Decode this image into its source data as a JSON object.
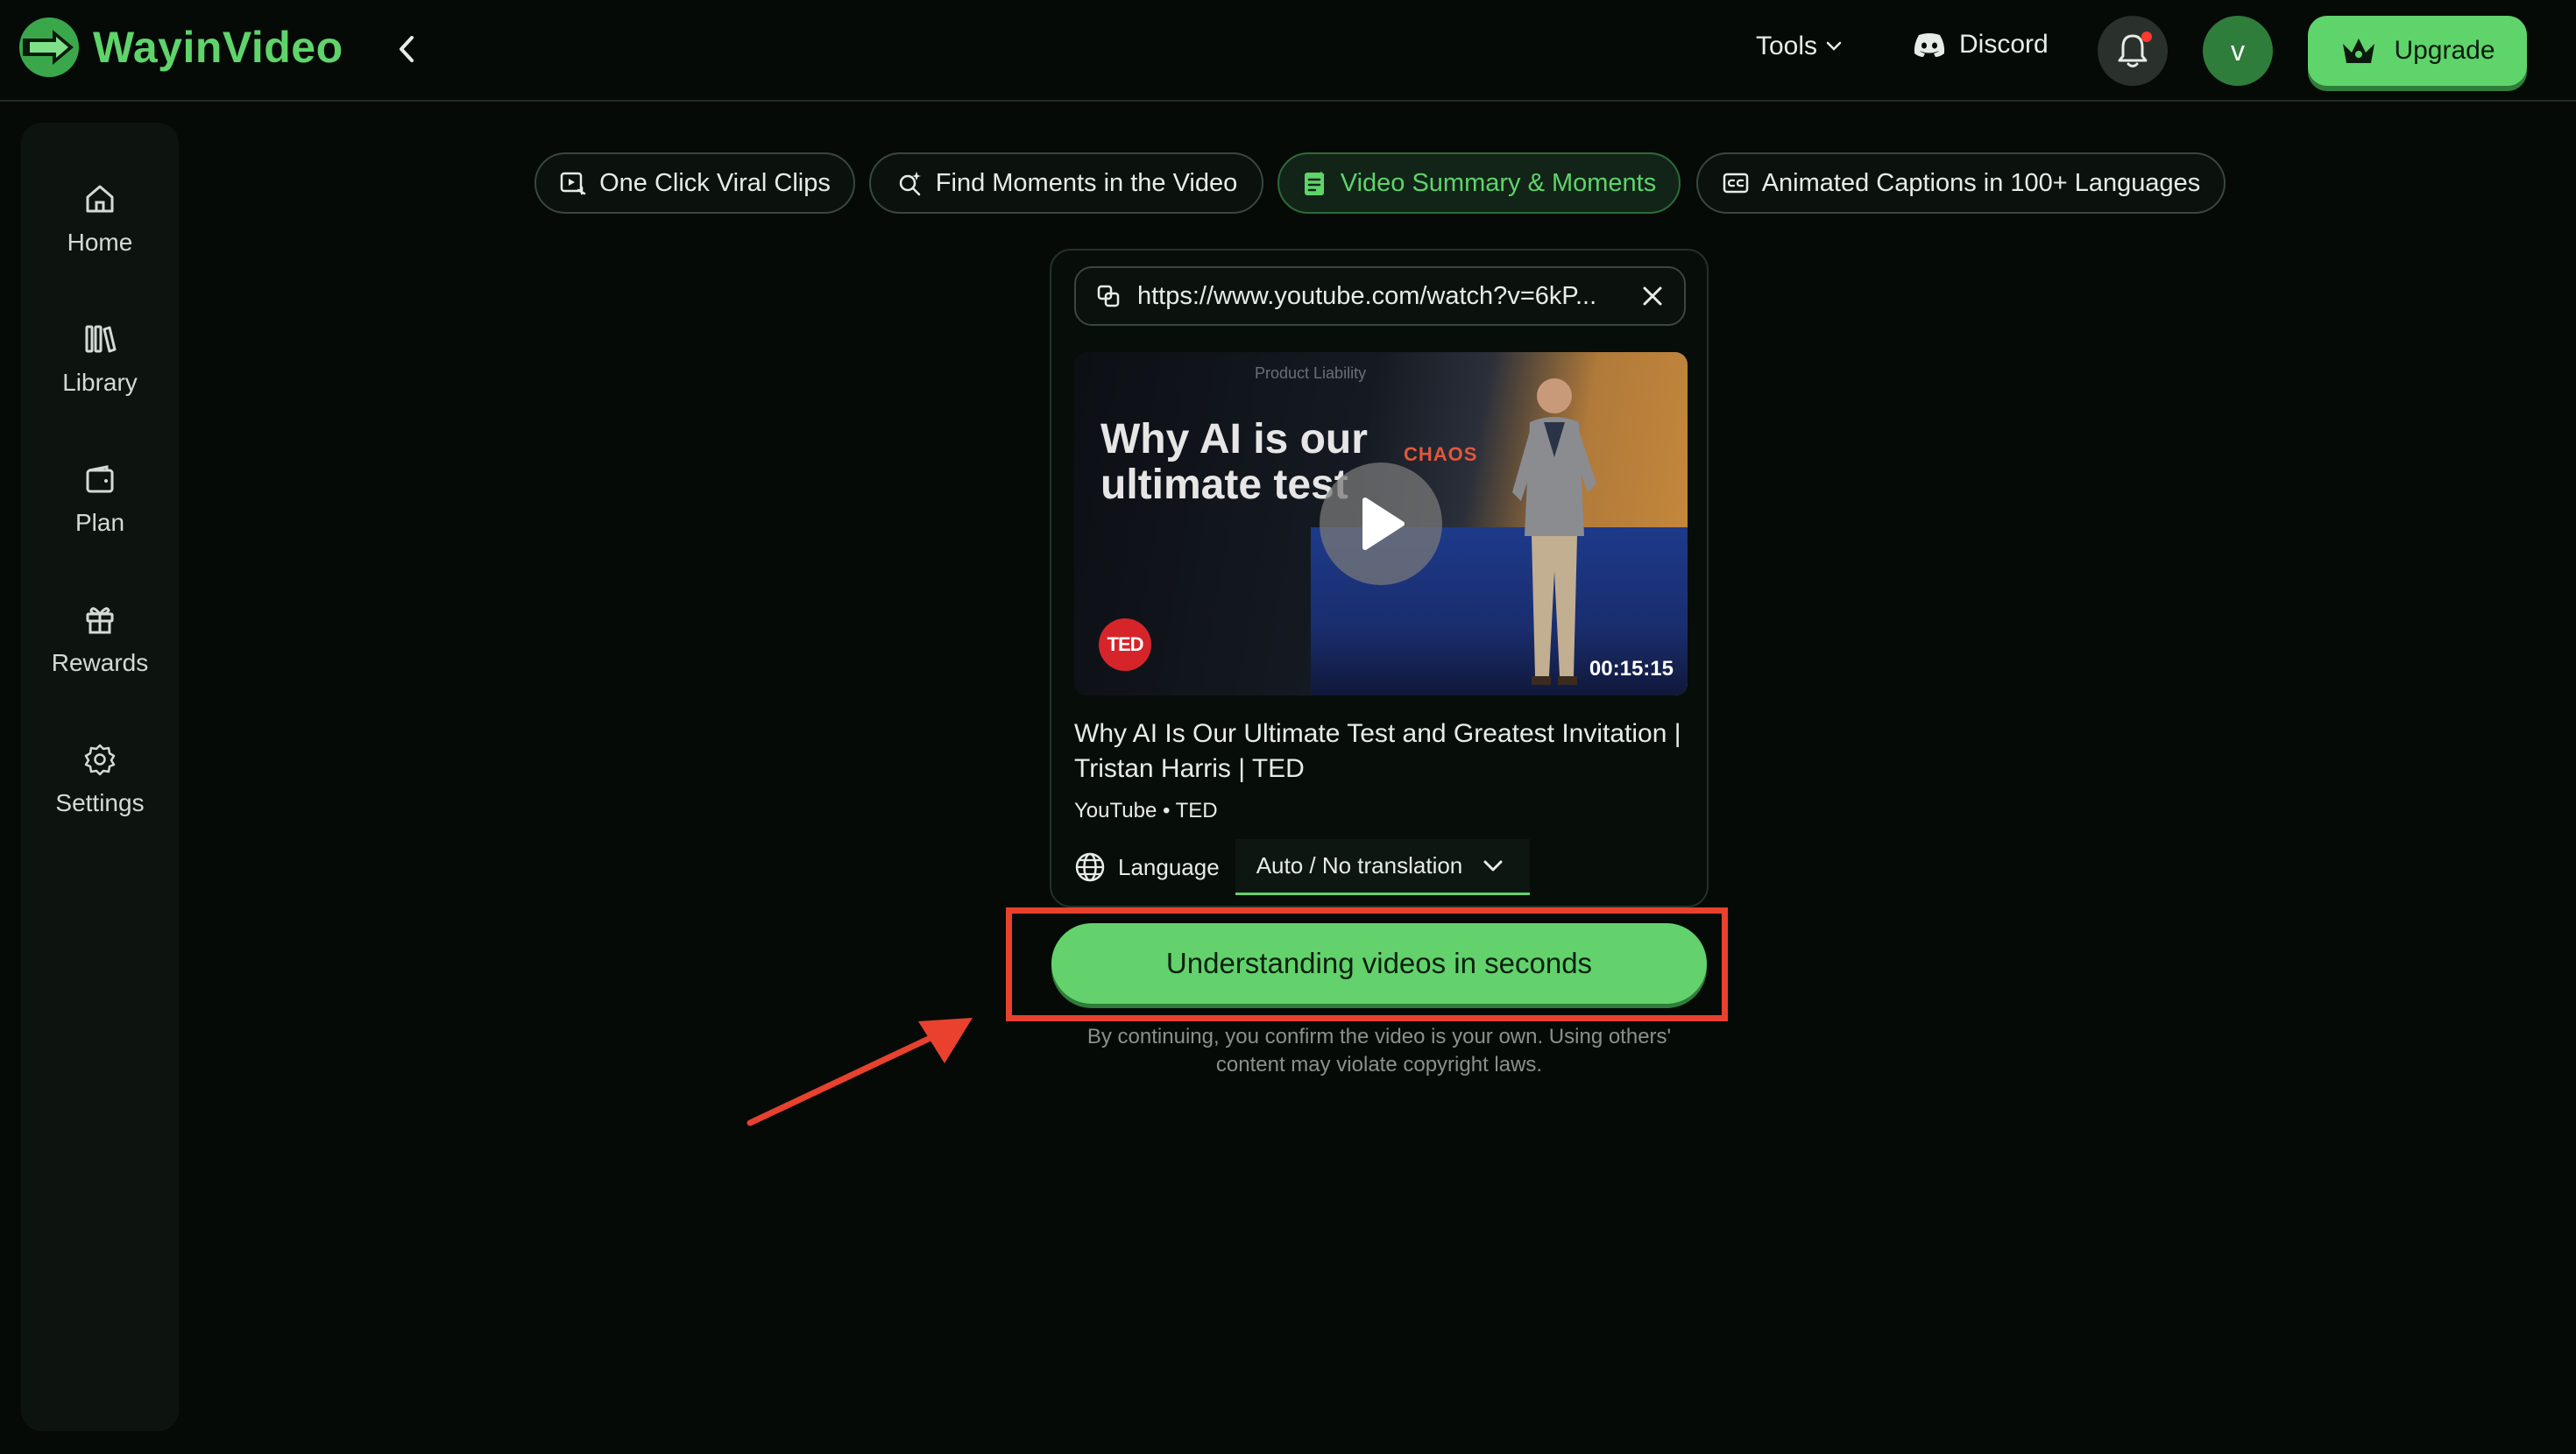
{
  "app": {
    "name": "WayinVideo",
    "brand_color": "#5fd46a"
  },
  "header": {
    "tools_label": "Tools",
    "discord_label": "Discord",
    "avatar_initial": "v",
    "upgrade_label": "Upgrade"
  },
  "sidebar": {
    "items": [
      {
        "label": "Home",
        "icon": "home-icon"
      },
      {
        "label": "Library",
        "icon": "library-icon"
      },
      {
        "label": "Plan",
        "icon": "wallet-icon"
      },
      {
        "label": "Rewards",
        "icon": "gift-icon"
      },
      {
        "label": "Settings",
        "icon": "gear-icon"
      }
    ]
  },
  "tabs": [
    {
      "label": "One Click Viral Clips",
      "icon": "clip-icon",
      "active": false
    },
    {
      "label": "Find Moments in the Video",
      "icon": "magic-search-icon",
      "active": false
    },
    {
      "label": "Video Summary & Moments",
      "icon": "summary-icon",
      "active": true
    },
    {
      "label": "Animated Captions in 100+ Languages",
      "icon": "captions-icon",
      "active": false
    }
  ],
  "input": {
    "url": "https://www.youtube.com/watch?v=6kP..."
  },
  "video": {
    "thumb_title": "Why AI is our ultimate test",
    "thumb_chaos": "CHAOS",
    "thumb_caption": "Product Liability",
    "thumb_badge": "TED",
    "duration": "00:15:15",
    "title": "Why AI Is Our Ultimate Test and Greatest Invitation | Tristan Harris | TED",
    "meta": "YouTube • TED"
  },
  "language": {
    "label": "Language",
    "selected": "Auto / No translation"
  },
  "cta": {
    "label": "Understanding videos in seconds",
    "disclaimer": "By continuing, you confirm the video is your own. Using others' content may violate copyright laws.",
    "highlight_color": "#e8412e"
  }
}
